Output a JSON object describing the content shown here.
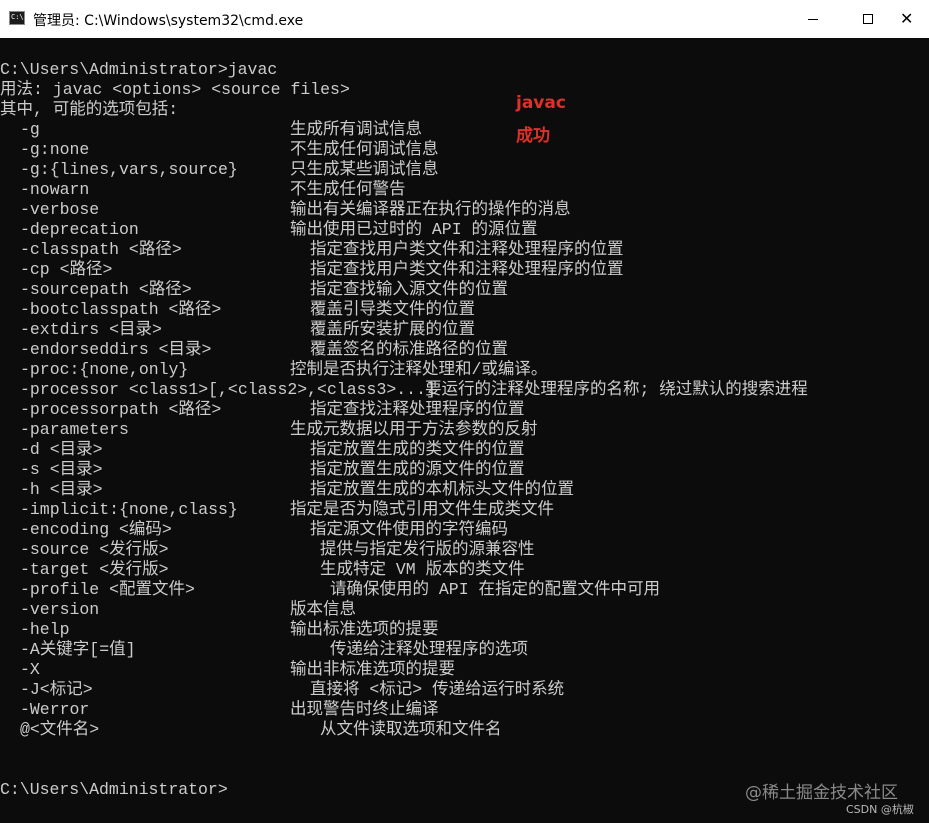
{
  "window": {
    "title": "管理员: C:\\Windows\\system32\\cmd.exe",
    "icon": "cmd-icon",
    "icon_text": "C:\\",
    "minimize_icon": "minimize-icon",
    "maximize_icon": "maximize-icon",
    "close_icon": "close-icon",
    "close_glyph": "✕"
  },
  "console": {
    "command_line": "C:\\Users\\Administrator>javac",
    "usage_line": "用法: javac <options> <source files>",
    "options_intro": "其中, 可能的选项包括:",
    "options": [
      {
        "opt": "-g",
        "desc": "生成所有调试信息"
      },
      {
        "opt": "-g:none",
        "desc": "不生成任何调试信息"
      },
      {
        "opt": "-g:{lines,vars,source}",
        "desc": "只生成某些调试信息"
      },
      {
        "opt": "-nowarn",
        "desc": "不生成任何警告"
      },
      {
        "opt": "-verbose",
        "desc": "输出有关编译器正在执行的操作的消息"
      },
      {
        "opt": "-deprecation",
        "desc": "输出使用已过时的 API 的源位置"
      },
      {
        "opt": "-classpath <路径>",
        "desc": "指定查找用户类文件和注释处理程序的位置"
      },
      {
        "opt": "-cp <路径>",
        "desc": "指定查找用户类文件和注释处理程序的位置"
      },
      {
        "opt": "-sourcepath <路径>",
        "desc": "指定查找输入源文件的位置"
      },
      {
        "opt": "-bootclasspath <路径>",
        "desc": "覆盖引导类文件的位置"
      },
      {
        "opt": "-extdirs <目录>",
        "desc": "覆盖所安装扩展的位置"
      },
      {
        "opt": "-endorseddirs <目录>",
        "desc": "覆盖签名的标准路径的位置"
      },
      {
        "opt": "-proc:{none,only}",
        "desc": "控制是否执行注释处理和/或编译。"
      },
      {
        "opt": "-processor <class1>[,<class2>,<class3>...]",
        "desc": "要运行的注释处理程序的名称; 绕过默认的搜索进程"
      },
      {
        "opt": "-processorpath <路径>",
        "desc": "指定查找注释处理程序的位置"
      },
      {
        "opt": "-parameters",
        "desc": "生成元数据以用于方法参数的反射"
      },
      {
        "opt": "-d <目录>",
        "desc": "指定放置生成的类文件的位置"
      },
      {
        "opt": "-s <目录>",
        "desc": "指定放置生成的源文件的位置"
      },
      {
        "opt": "-h <目录>",
        "desc": "指定放置生成的本机标头文件的位置"
      },
      {
        "opt": "-implicit:{none,class}",
        "desc": "指定是否为隐式引用文件生成类文件"
      },
      {
        "opt": "-encoding <编码>",
        "desc": "指定源文件使用的字符编码"
      },
      {
        "opt": "-source <发行版>",
        "desc": "提供与指定发行版的源兼容性"
      },
      {
        "opt": "-target <发行版>",
        "desc": "生成特定 VM 版本的类文件"
      },
      {
        "opt": "-profile <配置文件>",
        "desc": "请确保使用的 API 在指定的配置文件中可用"
      },
      {
        "opt": "-version",
        "desc": "版本信息"
      },
      {
        "opt": "-help",
        "desc": "输出标准选项的提要"
      },
      {
        "opt": "-A关键字[=值]",
        "desc": "传递给注释处理程序的选项"
      },
      {
        "opt": "-X",
        "desc": "输出非标准选项的提要"
      },
      {
        "opt": "-J<标记>",
        "desc": "直接将 <标记> 传递给运行时系统"
      },
      {
        "opt": "-Werror",
        "desc": "出现警告时终止编译"
      },
      {
        "opt": "@<文件名>",
        "desc": "从文件读取选项和文件名"
      }
    ],
    "prompt_line": "C:\\Users\\Administrator>"
  },
  "annotation": {
    "line1": "javac",
    "line2": "成功",
    "color": "#e0302a"
  },
  "watermark": {
    "main": "@稀土掘金技术社区",
    "sub": "CSDN @杭椒"
  },
  "colors": {
    "console_bg": "#0c0c0c",
    "console_text": "#cccccc",
    "titlebar_bg": "#ffffff"
  }
}
